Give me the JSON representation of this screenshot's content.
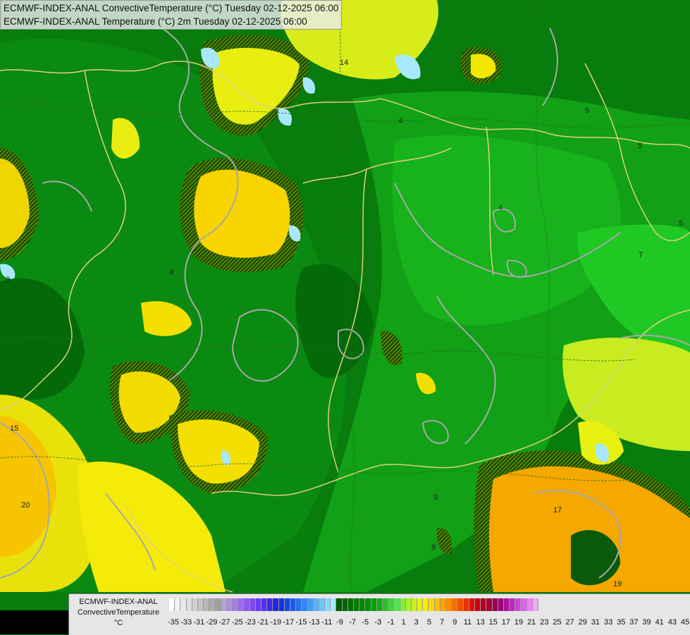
{
  "title": {
    "line1": "ECMWF-INDEX-ANAL ConvectiveTemperature (°C) Tuesday 02-12-2025 06:00",
    "line2": "ECMWF-INDEX-ANAL Temperature (°C) 2m Tuesday 02-12-2025 06:00"
  },
  "legend": {
    "source": "ECMWF-INDEX-ANAL",
    "variable": "ConvectiveTemperature",
    "unit": "°C",
    "ticks": [
      "-35",
      "-33",
      "-31",
      "-29",
      "-27",
      "-25",
      "-23",
      "-21",
      "-19",
      "-17",
      "-15",
      "-13",
      "-11",
      "-9",
      "-7",
      "-5",
      "-3",
      "-1",
      "1",
      "3",
      "5",
      "7",
      "9",
      "11",
      "13",
      "15",
      "17",
      "19",
      "21",
      "23",
      "25",
      "27",
      "29",
      "31",
      "33",
      "35",
      "37",
      "39",
      "41",
      "43",
      "45"
    ],
    "colors": [
      "#ffffff",
      "#f4f4f4",
      "#e8e8e8",
      "#dcdcdc",
      "#d0d0d0",
      "#c4c4c4",
      "#b8b8b8",
      "#acacac",
      "#a0a0a0",
      "#b9a0d8",
      "#b08ee0",
      "#a67ce6",
      "#9a6aea",
      "#8d58ee",
      "#7e48f0",
      "#6a3cf2",
      "#5530f2",
      "#3c28f0",
      "#2424e6",
      "#1432e6",
      "#1446ea",
      "#1e5af0",
      "#2870f2",
      "#3486f4",
      "#449cf6",
      "#58b2f8",
      "#6cc6fa",
      "#86d8fc",
      "#a8e8fe",
      "#005a00",
      "#006600",
      "#007000",
      "#007a00",
      "#008600",
      "#009200",
      "#00a000",
      "#10b010",
      "#28c028",
      "#40d040",
      "#58e058",
      "#80ec40",
      "#a8f02a",
      "#c8f01a",
      "#e4f010",
      "#f8f000",
      "#fad800",
      "#fbc000",
      "#fca400",
      "#fc8c00",
      "#fa6e00",
      "#f45000",
      "#ec3000",
      "#e01010",
      "#cc0010",
      "#b80020",
      "#a80030",
      "#980050",
      "#a00078",
      "#b0109a",
      "#c028bc",
      "#d044d8",
      "#e060ec",
      "#ee80f6",
      "#f4a4fa"
    ],
    "tick_start_index": 0
  }
}
